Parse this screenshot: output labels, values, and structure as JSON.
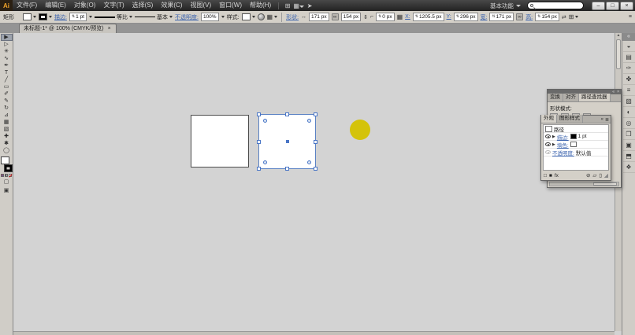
{
  "titlebar": {
    "logo": "Ai",
    "menus": [
      "文件(F)",
      "编辑(E)",
      "对象(O)",
      "文字(T)",
      "选择(S)",
      "效果(C)",
      "视图(V)",
      "窗口(W)",
      "帮助(H)"
    ],
    "workspace": "基本功能",
    "window_buttons": {
      "minimize": "–",
      "maximize": "□",
      "close": "×"
    }
  },
  "control_bar": {
    "tool_label": "矩形",
    "stroke_link": "描边:",
    "stroke_weight": "1 pt",
    "width_profile": "等比",
    "brush_def": "基本",
    "opacity_link": "不透明度:",
    "opacity_value": "100%",
    "style_label": "样式:",
    "shape_link": "形状:",
    "shape_width": "171 px",
    "shape_height": "154 px",
    "corner_radius": "0 px",
    "x_label": "X:",
    "x_value": "1205.5 px",
    "y_label": "Y:",
    "y_value": "296 px",
    "w_label": "宽:",
    "w_value": "171 px",
    "h_label": "高:",
    "h_value": "154 px"
  },
  "document_tab": {
    "title": "未标题-1* @ 100% (CMYK/预览)",
    "close_label": "×"
  },
  "toolbar": {
    "tools": [
      {
        "name": "selection-tool",
        "glyph": "▶",
        "active": true
      },
      {
        "name": "direct-selection-tool",
        "glyph": "▷"
      },
      {
        "name": "magic-wand-tool",
        "glyph": "✳"
      },
      {
        "name": "lasso-tool",
        "glyph": "∿"
      },
      {
        "name": "pen-tool",
        "glyph": "✒"
      },
      {
        "name": "type-tool",
        "glyph": "T"
      },
      {
        "name": "line-segment-tool",
        "glyph": "╱"
      },
      {
        "name": "rectangle-tool",
        "glyph": "▭"
      },
      {
        "name": "paintbrush-tool",
        "glyph": "✐"
      },
      {
        "name": "pencil-tool",
        "glyph": "✎"
      },
      {
        "name": "rotate-tool",
        "glyph": "↻"
      },
      {
        "name": "scale-tool",
        "glyph": "⊿"
      },
      {
        "name": "mesh-tool",
        "glyph": "▦"
      },
      {
        "name": "gradient-tool",
        "glyph": "▧"
      },
      {
        "name": "eyedropper-tool",
        "glyph": "✚"
      },
      {
        "name": "hand-tool",
        "glyph": "✱"
      },
      {
        "name": "zoom-tool",
        "glyph": "◯"
      }
    ]
  },
  "canvas": {
    "square_fill": "#ffffff",
    "selection_color": "#4a76c6",
    "circle_color": "#d4c30a"
  },
  "dock": {
    "icons": [
      {
        "name": "color-panel-icon",
        "glyph": "◒"
      },
      {
        "name": "swatches-panel-icon",
        "glyph": "▤"
      },
      {
        "name": "brushes-panel-icon",
        "glyph": "✑"
      },
      {
        "name": "symbols-panel-icon",
        "glyph": "✤"
      },
      {
        "name": "stroke-panel-icon",
        "glyph": "≡"
      },
      {
        "name": "gradient-panel-icon",
        "glyph": "▧"
      },
      {
        "name": "transparency-panel-icon",
        "glyph": "◐"
      },
      {
        "name": "appearance-panel-icon",
        "glyph": "◎"
      },
      {
        "name": "graphic-styles-panel-icon",
        "glyph": "❒"
      },
      {
        "name": "layers-panel-icon",
        "glyph": "▣"
      },
      {
        "name": "artboards-panel-icon",
        "glyph": "⬒"
      },
      {
        "name": "pathfinder-panel-icon",
        "glyph": "❖"
      }
    ]
  },
  "pathfinder_panel": {
    "tabs": [
      {
        "name": "tab-transform",
        "label": "变换"
      },
      {
        "name": "tab-align",
        "label": "对齐"
      },
      {
        "name": "tab-pathfinder",
        "label": "路径查找器",
        "active": true
      }
    ],
    "shape_modes_label": "形状模式:",
    "shape_modes": [
      {
        "name": "unite-button",
        "glyph": "■"
      },
      {
        "name": "minus-front-button",
        "glyph": "◳"
      },
      {
        "name": "intersect-button",
        "glyph": "◧"
      },
      {
        "name": "exclude-button",
        "glyph": "▩"
      }
    ],
    "close_label": "×"
  },
  "appearance_panel": {
    "tabs": [
      {
        "name": "tab-appearance",
        "label": "外观",
        "active": true
      },
      {
        "name": "tab-graphic-styles",
        "label": "图形样式"
      }
    ],
    "path_row_label": "路径",
    "stroke_row": {
      "label": "描边:",
      "value": "1 pt"
    },
    "fill_row": {
      "label": "填色:"
    },
    "opacity_row": {
      "label": "不透明度:",
      "value": "默认值"
    },
    "fx_label": "fx"
  }
}
